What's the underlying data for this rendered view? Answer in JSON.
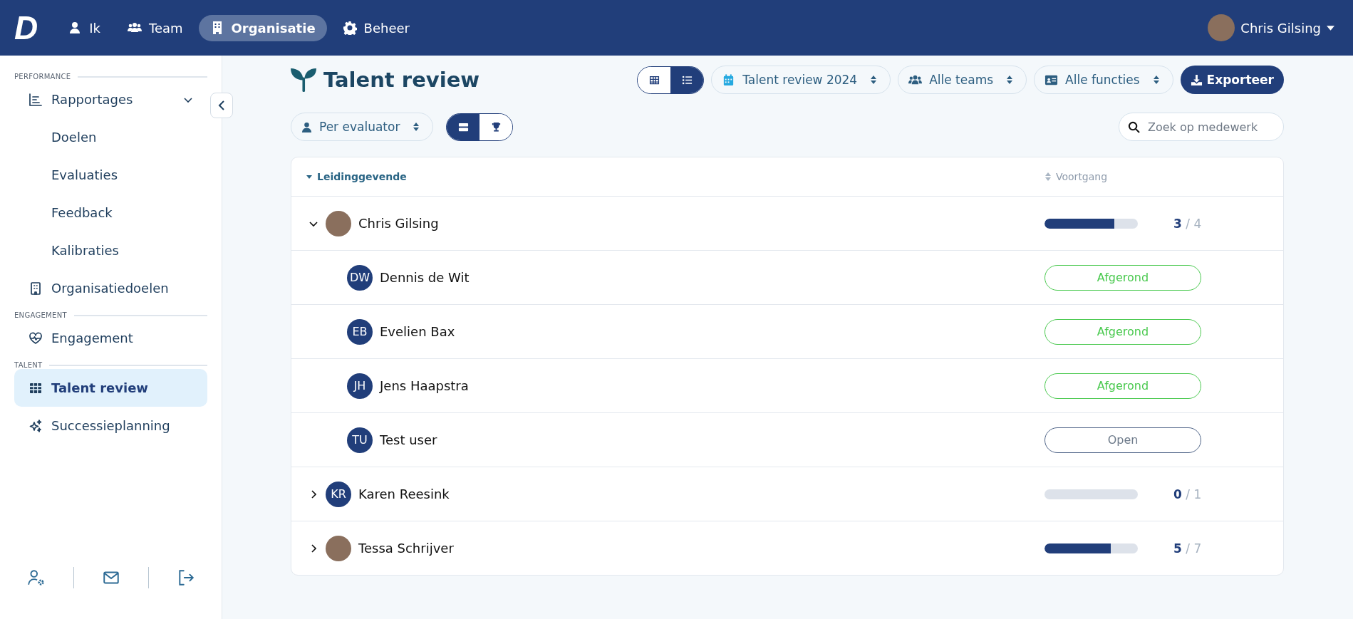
{
  "topbar": {
    "logo": "D",
    "nav": [
      {
        "label": "Ik",
        "selected": false
      },
      {
        "label": "Team",
        "selected": false
      },
      {
        "label": "Organisatie",
        "selected": true
      },
      {
        "label": "Beheer",
        "selected": false
      }
    ],
    "user": {
      "name": "Chris Gilsing"
    }
  },
  "sidebar": {
    "sections": [
      {
        "title": "PERFORMANCE",
        "items": [
          {
            "label": "Rapportages",
            "selected": false,
            "expanded": true,
            "children": [
              {
                "label": "Doelen",
                "selected": false
              },
              {
                "label": "Evaluaties",
                "selected": false
              },
              {
                "label": "Feedback",
                "selected": false
              },
              {
                "label": "Kalibraties",
                "selected": false
              }
            ]
          },
          {
            "label": "Organisatiedoelen",
            "selected": false
          }
        ]
      },
      {
        "title": "ENGAGEMENT",
        "items": [
          {
            "label": "Engagement",
            "selected": false
          }
        ]
      },
      {
        "title": "TALENT",
        "items": [
          {
            "label": "Talent review",
            "selected": true
          },
          {
            "label": "Successieplanning",
            "selected": false
          }
        ]
      }
    ]
  },
  "page": {
    "title": "Talent review",
    "view_toggle": [
      {
        "selected": false
      },
      {
        "selected": true
      }
    ],
    "filters": [
      {
        "label": "Talent review 2024"
      },
      {
        "label": "Alle teams"
      },
      {
        "label": "Alle functies"
      }
    ],
    "export_button": "Exporteer",
    "group_filter": "Per evaluator",
    "mode_toggle": [
      {
        "selected": true
      },
      {
        "selected": false
      }
    ],
    "search": {
      "placeholder": "Zoek op medewerk"
    }
  },
  "table": {
    "columns": [
      {
        "label": "Leidinggevende",
        "sorted": true
      },
      {
        "label": "Voortgang",
        "sorted": false
      }
    ],
    "rows": [
      {
        "name": "Chris Gilsing",
        "expanded": true,
        "level": 0.75,
        "done": "3",
        "total": "/ 4",
        "children": [
          {
            "name": "Dennis de Wit",
            "initials": "DW",
            "status": "Afgerond",
            "kind": "done"
          },
          {
            "name": "Evelien Bax",
            "initials": "EB",
            "status": "Afgerond",
            "kind": "done"
          },
          {
            "name": "Jens Haapstra",
            "initials": "JH",
            "status": "Afgerond",
            "kind": "done"
          },
          {
            "name": "Test user",
            "initials": "TU",
            "status": "Open",
            "kind": "open"
          }
        ]
      },
      {
        "name": "Karen Reesink",
        "initials": "KR",
        "expanded": false,
        "level": 0,
        "done": "0",
        "total": "/ 1"
      },
      {
        "name": "Tessa Schrijver",
        "expanded": false,
        "level": 0.71,
        "done": "5",
        "total": "/ 7"
      }
    ]
  }
}
